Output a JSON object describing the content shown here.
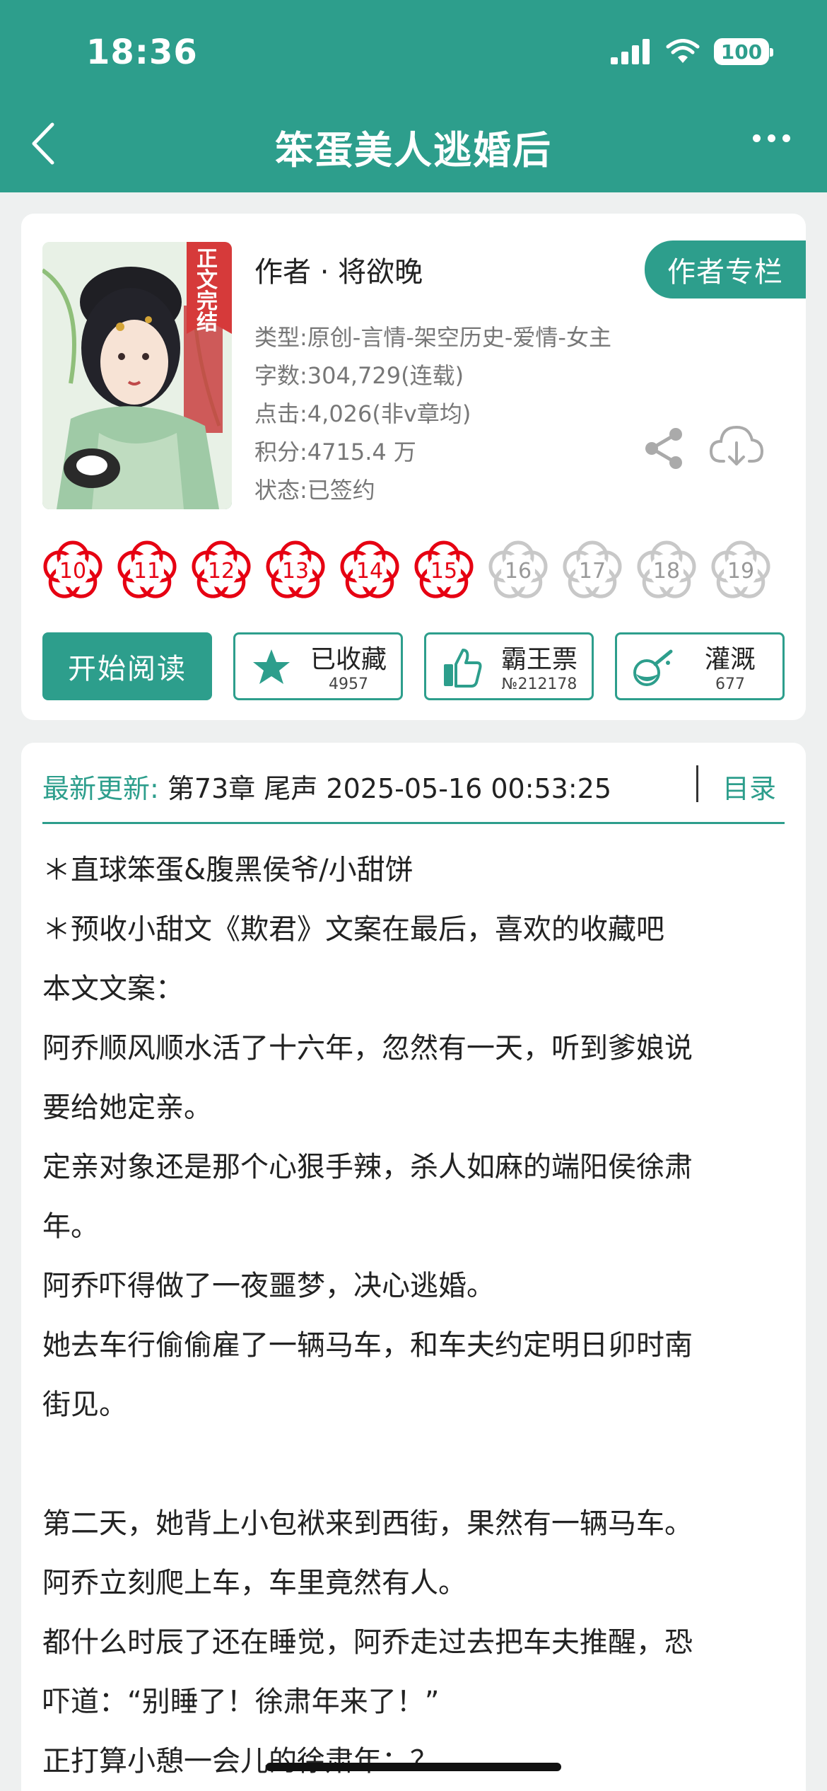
{
  "status_bar": {
    "time": "18:36",
    "battery": "100"
  },
  "nav": {
    "title": "笨蛋美人逃婚后"
  },
  "book": {
    "cover_badge": "正文完结",
    "author": "作者 · 将欲晚",
    "author_column_button": "作者专栏",
    "type": "类型:原创-言情-架空历史-爱情-女主",
    "word_count": "字数:304,729(连载)",
    "clicks": "点击:4,026(非v章均)",
    "points": "积分:4715.4 万",
    "status": "状态:已签约"
  },
  "chapter_flowers": [
    {
      "num": "10",
      "active": true
    },
    {
      "num": "11",
      "active": true
    },
    {
      "num": "12",
      "active": true
    },
    {
      "num": "13",
      "active": true
    },
    {
      "num": "14",
      "active": true
    },
    {
      "num": "15",
      "active": true
    },
    {
      "num": "16",
      "active": false
    },
    {
      "num": "17",
      "active": false
    },
    {
      "num": "18",
      "active": false
    },
    {
      "num": "19",
      "active": false
    }
  ],
  "actions": {
    "read": "开始阅读",
    "collect_label": "已收藏",
    "collect_count": "4957",
    "ticket_label": "霸王票",
    "ticket_count": "№212178",
    "water_label": "灌溉",
    "water_count": "677"
  },
  "update": {
    "label": "最新更新:",
    "text": "第73章 尾声 2025-05-16 00:53:25",
    "toc": "目录"
  },
  "description": [
    "＊直球笨蛋&腹黑侯爷/小甜饼",
    "＊预收小甜文《欺君》文案在最后，喜欢的收藏吧",
    "本文文案：",
    "阿乔顺风顺水活了十六年，忽然有一天，听到爹娘说",
    "要给她定亲。",
    "定亲对象还是那个心狠手辣，杀人如麻的端阳侯徐肃",
    "年。",
    "阿乔吓得做了一夜噩梦，决心逃婚。",
    "她去车行偷偷雇了一辆马车，和车夫约定明日卯时南",
    "街见。",
    "",
    "第二天，她背上小包袱来到西街，果然有一辆马车。",
    "阿乔立刻爬上车，车里竟然有人。",
    "都什么时辰了还在睡觉，阿乔走过去把车夫推醒，恐",
    "吓道：“别睡了！徐肃年来了！”",
    "正打算小憩一会儿的徐肃年：？"
  ],
  "colors": {
    "accent": "#2d9e8c",
    "flower_active": "#e60012",
    "flower_inactive": "#c8c8c8"
  }
}
